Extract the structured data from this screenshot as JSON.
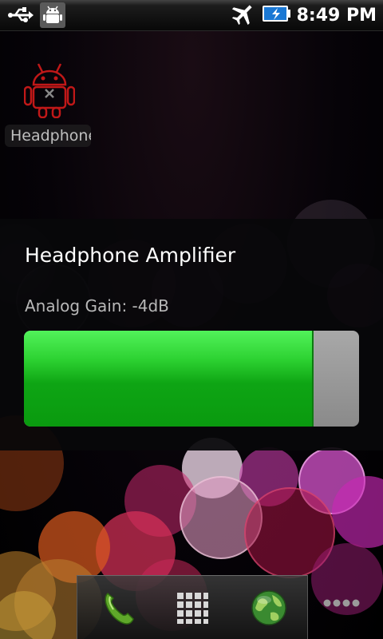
{
  "status_bar": {
    "time": "8:49 PM",
    "icons": [
      "usb-icon",
      "android-debug-icon",
      "airplane-mode-icon",
      "battery-charging-icon"
    ]
  },
  "home": {
    "shortcut_label": "Headphone Amplifier",
    "shortcut_icon": "android-app-icon"
  },
  "dialog": {
    "title": "Headphone Amplifier",
    "gain_label": "Analog Gain: -4dB",
    "gain_level_fraction": 0.86,
    "colors": {
      "fill": "#1fbf26",
      "track": "#999999"
    }
  },
  "dock": {
    "items": [
      {
        "name": "phone-icon"
      },
      {
        "name": "app-drawer-icon"
      },
      {
        "name": "browser-globe-icon"
      }
    ],
    "overflow": "more-dots-icon"
  }
}
